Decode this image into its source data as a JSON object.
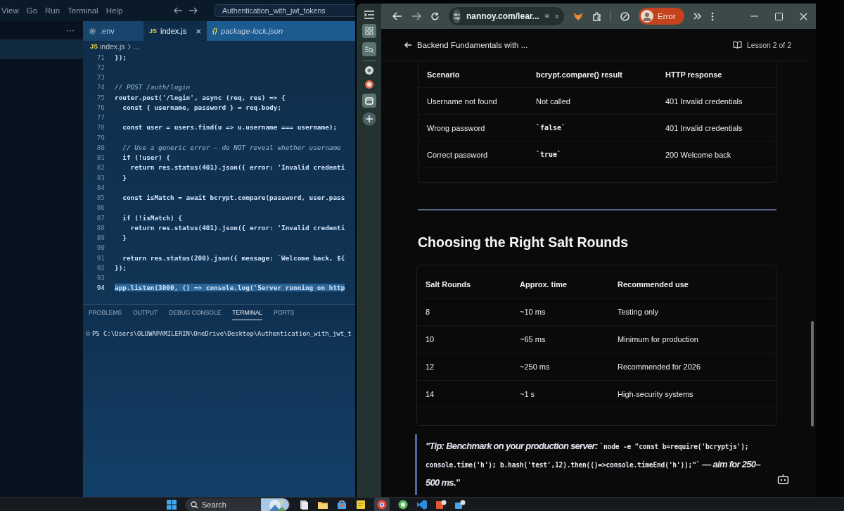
{
  "editor": {
    "menu": [
      "View",
      "Go",
      "Run",
      "Terminal",
      "Help"
    ],
    "command_center": "Authentication_with_jwt_tokens",
    "explorer_more": "···",
    "tabs": [
      {
        "label": ".env",
        "kind": "gear",
        "selected": false,
        "preview": false
      },
      {
        "label": "index.js",
        "kind": "badge",
        "badge": "JS",
        "selected": true,
        "preview": false,
        "close": "×"
      },
      {
        "label": "package-lock.json",
        "kind": "badge",
        "badge": "{}",
        "selected": false,
        "preview": true
      }
    ],
    "breadcrumb": {
      "badge": "JS",
      "file": "index.js",
      "more": "..."
    },
    "lines": [
      {
        "number": "71",
        "code": "});",
        "kind": "code",
        "selected": false
      },
      {
        "number": "72",
        "selected": false
      },
      {
        "number": "73",
        "selected": false
      },
      {
        "number": "74",
        "code": "// POST /auth/login",
        "kind": "comment",
        "selected": false
      },
      {
        "number": "75",
        "code": "router.post('/login', async (req, res) => {",
        "kind": "code",
        "selected": false
      },
      {
        "number": "76",
        "code": "  const { username, password } = req.body;",
        "kind": "code",
        "selected": false
      },
      {
        "number": "77",
        "selected": false
      },
      {
        "number": "78",
        "code": "  const user = users.find(u => u.username === username);",
        "kind": "code",
        "selected": false
      },
      {
        "number": "79",
        "selected": false
      },
      {
        "number": "80",
        "code": "  // Use a generic error — do NOT reveal whether username",
        "kind": "comment",
        "selected": false
      },
      {
        "number": "81",
        "code": "  if (!user) {",
        "kind": "code",
        "selected": false
      },
      {
        "number": "82",
        "code": "    return res.status(401).json({ error: 'Invalid credenti",
        "kind": "code",
        "selected": false
      },
      {
        "number": "83",
        "code": "  }",
        "kind": "code",
        "selected": false
      },
      {
        "number": "84",
        "selected": false
      },
      {
        "number": "85",
        "code": "  const isMatch = await bcrypt.compare(password, user.pass",
        "kind": "code",
        "selected": false
      },
      {
        "number": "86",
        "selected": false
      },
      {
        "number": "87",
        "code": "  if (!isMatch) {",
        "kind": "code",
        "selected": false
      },
      {
        "number": "88",
        "code": "    return res.status(401).json({ error: 'Invalid credenti",
        "kind": "code",
        "selected": false
      },
      {
        "number": "89",
        "code": "  }",
        "kind": "code",
        "selected": false
      },
      {
        "number": "90",
        "selected": false
      },
      {
        "number": "91",
        "code": "  return res.status(200).json({ message: `Welcome back, ${",
        "kind": "code",
        "selected": false
      },
      {
        "number": "92",
        "code": "});",
        "kind": "code",
        "selected": false
      },
      {
        "number": "93",
        "selected": false
      },
      {
        "number": "94",
        "code": "app.listen(3000, () => console.log('Server running on http",
        "kind": "code",
        "selected": true
      }
    ],
    "panel_tabs": [
      {
        "label": "PROBLEMS",
        "selected": false
      },
      {
        "label": "OUTPUT",
        "selected": false
      },
      {
        "label": "DEBUG CONSOLE",
        "selected": false
      },
      {
        "label": "TERMINAL",
        "selected": true
      },
      {
        "label": "PORTS",
        "selected": false
      }
    ],
    "terminal": "PS C:\\Users\\OLUWAPAMILERIN\\OneDrive\\Desktop\\Authentication_with_jwt_t"
  },
  "browser": {
    "url": "nannoy.com/lear...",
    "profile": "Error",
    "course_title": "Backend Fundamentals with ...",
    "lesson": "Lesson 2 of 2",
    "table_1": {
      "columns": [
        "Scenario",
        "bcrypt.compare() result",
        "HTTP response"
      ],
      "rows": [
        [
          {
            "text": "Username not found",
            "kind": "text"
          },
          {
            "text": "Not called",
            "kind": "text"
          },
          {
            "text": "401 Invalid credentials",
            "kind": "text"
          }
        ],
        [
          {
            "text": "Wrong password",
            "kind": "text"
          },
          {
            "text": "`false`",
            "kind": "code"
          },
          {
            "text": "401 Invalid credentials",
            "kind": "text"
          }
        ],
        [
          {
            "text": "Correct password",
            "kind": "text"
          },
          {
            "text": "`true`",
            "kind": "code"
          },
          {
            "text": "200 Welcome back",
            "kind": "text"
          }
        ]
      ]
    },
    "heading": "Choosing the Right Salt Rounds",
    "table_2": {
      "columns": [
        "Salt Rounds",
        "Approx. time",
        "Recommended use"
      ],
      "rows": [
        [
          {
            "text": "8",
            "kind": "text"
          },
          {
            "text": "~10 ms",
            "kind": "text"
          },
          {
            "text": "Testing only",
            "kind": "text"
          }
        ],
        [
          {
            "text": "10",
            "kind": "text"
          },
          {
            "text": "~65 ms",
            "kind": "text"
          },
          {
            "text": "Minimum for production",
            "kind": "text"
          }
        ],
        [
          {
            "text": "12",
            "kind": "text"
          },
          {
            "text": "~250 ms",
            "kind": "text"
          },
          {
            "text": "Recommended for 2026",
            "kind": "text"
          }
        ],
        [
          {
            "text": "14",
            "kind": "text"
          },
          {
            "text": "~1 s",
            "kind": "text"
          },
          {
            "text": "High-security systems",
            "kind": "text"
          }
        ]
      ]
    },
    "tip": [
      {
        "kind": "prose",
        "text": "\"Tip: Benchmark on your production server: "
      },
      {
        "kind": "code",
        "text": "`node -e \"const b=require('bcryptjs'); console.time('h'); b.hash('test',12).then(()=>console.timeEnd('h'));\"`"
      },
      {
        "kind": "prose",
        "text": " — aim for 250–500 ms.\""
      }
    ]
  },
  "taskbar": {
    "search_placeholder": "Search"
  }
}
